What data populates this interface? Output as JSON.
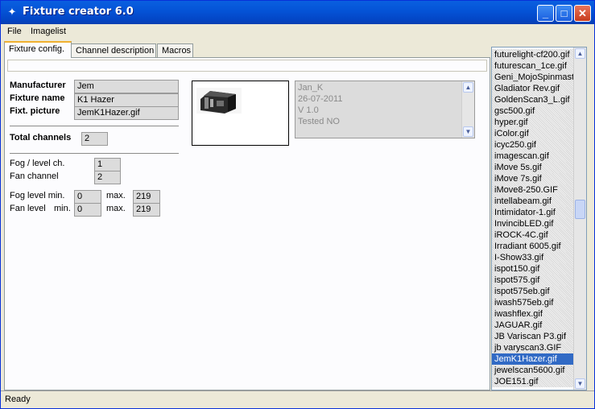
{
  "window": {
    "title": "Fixture creator 6.0",
    "title_icon": "app-icon"
  },
  "menu": [
    "File",
    "Imagelist"
  ],
  "tabs": [
    "Fixture config.",
    "Channel description",
    "Macros"
  ],
  "labels": {
    "manufacturer": "Manufacturer",
    "fixture_name": "Fixture name",
    "fixt_picture": "Fixt. picture",
    "total_channels": "Total channels",
    "fog_level_ch": "Fog / level ch.",
    "fan_channel": "Fan channel",
    "fog_level_min": "Fog level min.",
    "fan_level": "Fan level",
    "min": "min.",
    "max": "max."
  },
  "values": {
    "manufacturer": "Jem",
    "fixture_name": "K1 Hazer",
    "fixt_picture": "JemK1Hazer.gif",
    "total_channels": "2",
    "fog_level_ch": "1",
    "fan_channel": "2",
    "fog_min": "0",
    "fog_max": "219",
    "fan_min": "0",
    "fan_max": "219"
  },
  "notes": [
    "Jan_K",
    "26-07-2011",
    "V 1.0",
    "Tested NO"
  ],
  "imagelist": {
    "items": [
      "futurelight-cf200.gif",
      "futurescan_1ce.gif",
      "Geni_MojoSpinmaste",
      "Gladiator Rev.gif",
      "GoldenScan3_L.gif",
      "gsc500.gif",
      "hyper.gif",
      "iColor.gif",
      "icyc250.gif",
      "imagescan.gif",
      "iMove 5s.gif",
      "iMove 7s.gif",
      "iMove8-250.GIF",
      "intellabeam.gif",
      "Intimidator-1.gif",
      "InvincibLED.gif",
      "iROCK-4C.gif",
      "Irradiant 6005.gif",
      "I-Show33.gif",
      "ispot150.gif",
      "ispot575.gif",
      "ispot575eb.gif",
      "iwash575eb.gif",
      "iwashflex.gif",
      "JAGUAR.gif",
      "JB Variscan P3.gif",
      "jb varyscan3.GIF",
      "JemK1Hazer.gif",
      "jewelscan5600.gif",
      "JOE151.gif"
    ],
    "selected": "JemK1Hazer.gif",
    "scroll_position": 0.47
  },
  "status": "Ready",
  "colors": {
    "titlebar": "#0453d6",
    "selection": "#316ac5",
    "window_bg": "#ece9d8"
  }
}
